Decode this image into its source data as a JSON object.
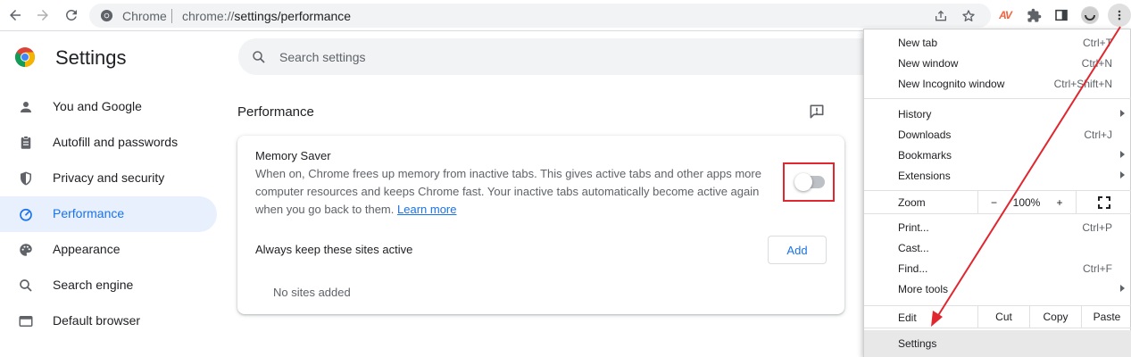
{
  "browser": {
    "site_label": "Chrome",
    "url_scheme": "chrome://",
    "url_path": "settings/performance",
    "extension_badge": "AV"
  },
  "settings": {
    "title": "Settings",
    "search_placeholder": "Search settings"
  },
  "sidebar": {
    "items": [
      {
        "label": "You and Google",
        "icon": "person-icon"
      },
      {
        "label": "Autofill and passwords",
        "icon": "clipboard-icon"
      },
      {
        "label": "Privacy and security",
        "icon": "shield-icon"
      },
      {
        "label": "Performance",
        "icon": "speedometer-icon",
        "active": true
      },
      {
        "label": "Appearance",
        "icon": "palette-icon"
      },
      {
        "label": "Search engine",
        "icon": "search-icon"
      },
      {
        "label": "Default browser",
        "icon": "browser-window-icon"
      }
    ]
  },
  "main": {
    "section_title": "Performance",
    "memory_saver": {
      "title": "Memory Saver",
      "description": "When on, Chrome frees up memory from inactive tabs. This gives active tabs and other apps more computer resources and keeps Chrome fast. Your inactive tabs automatically become active again when you go back to them.",
      "learn_more": "Learn more",
      "enabled": false
    },
    "always_active": {
      "label": "Always keep these sites active",
      "add_button": "Add",
      "empty_text": "No sites added"
    }
  },
  "menu": {
    "new_tab": {
      "label": "New tab",
      "shortcut": "Ctrl+T"
    },
    "new_window": {
      "label": "New window",
      "shortcut": "Ctrl+N"
    },
    "new_incognito": {
      "label": "New Incognito window",
      "shortcut": "Ctrl+Shift+N"
    },
    "history": {
      "label": "History"
    },
    "downloads": {
      "label": "Downloads",
      "shortcut": "Ctrl+J"
    },
    "bookmarks": {
      "label": "Bookmarks"
    },
    "extensions": {
      "label": "Extensions"
    },
    "zoom": {
      "label": "Zoom",
      "minus": "−",
      "value": "100%",
      "plus": "+"
    },
    "print": {
      "label": "Print...",
      "shortcut": "Ctrl+P"
    },
    "cast": {
      "label": "Cast..."
    },
    "find": {
      "label": "Find...",
      "shortcut": "Ctrl+F"
    },
    "more_tools": {
      "label": "More tools"
    },
    "edit": {
      "label": "Edit",
      "cut": "Cut",
      "copy": "Copy",
      "paste": "Paste"
    },
    "settings": {
      "label": "Settings"
    }
  },
  "colors": {
    "accent": "#1a73e8",
    "active_bg": "#e8f0fe",
    "annotation_red": "#e0262e"
  }
}
